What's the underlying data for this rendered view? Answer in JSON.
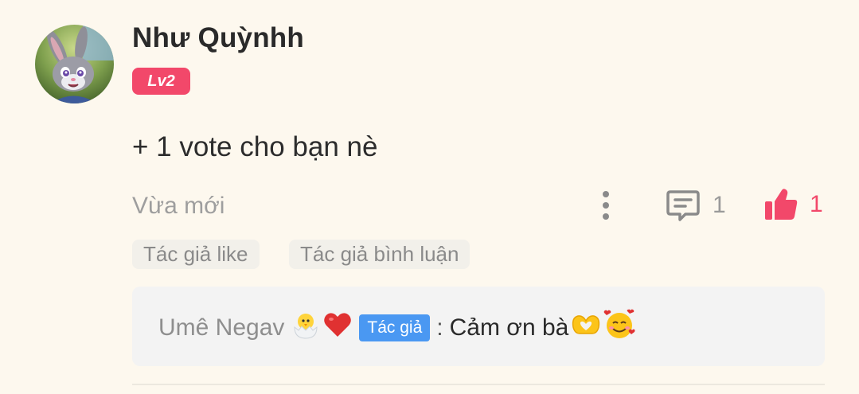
{
  "comment": {
    "username": "Như Quỳnhh",
    "level": "Lv2",
    "text": "+ 1 vote cho bạn nè",
    "timestamp": "Vừa mới",
    "reply_count": "1",
    "like_count": "1",
    "tags": [
      "Tác giả like",
      "Tác giả bình luận"
    ]
  },
  "reply": {
    "author": "Umê Negav",
    "author_badge": "Tác giả",
    "separator": ":",
    "message": "Cảm ơn bà"
  },
  "colors": {
    "background": "#fdf8ee",
    "level_badge": "#f2486a",
    "like": "#f2486a",
    "author_badge": "#4a98f2",
    "muted_text": "#9e9e9e",
    "tag_bg": "#f2f0ea",
    "reply_bg": "#f3f3f3"
  },
  "icons": {
    "avatar": "cartoon-bunny-avatar",
    "more": "vertical-dots-icon",
    "reply": "comment-bubble-icon",
    "like": "thumbs-up-icon",
    "reply_emojis": [
      "hatching-chick-emoji",
      "red-heart-emoji"
    ],
    "message_emojis": [
      "heart-hands-emoji",
      "smiling-face-with-hearts-emoji"
    ]
  }
}
